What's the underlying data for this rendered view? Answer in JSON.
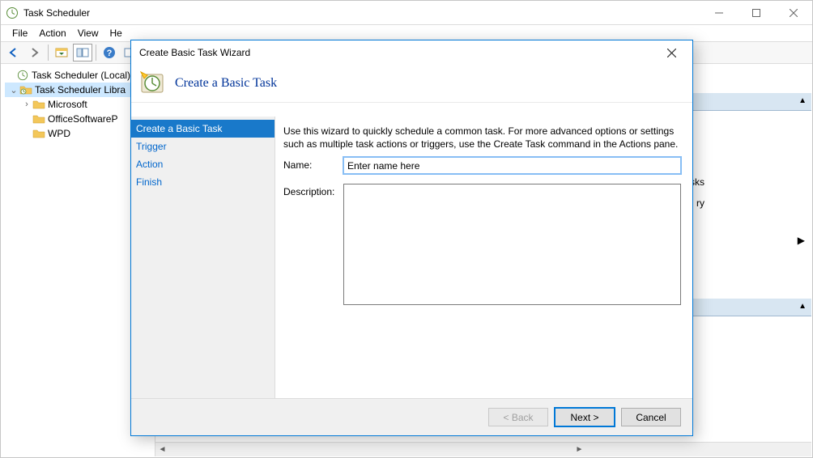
{
  "main_window": {
    "title": "Task Scheduler",
    "menu": {
      "file": "File",
      "action": "Action",
      "view": "View",
      "help": "He"
    },
    "tree": {
      "root": "Task Scheduler (Local)",
      "library": "Task Scheduler Libra",
      "items": [
        "Microsoft",
        "OfficeSoftwareP",
        "WPD"
      ]
    },
    "right_pane": {
      "side_asks": "asks",
      "side_ry": "ry"
    }
  },
  "dialog": {
    "title": "Create Basic Task Wizard",
    "header": "Create a Basic Task",
    "steps": [
      "Create a Basic Task",
      "Trigger",
      "Action",
      "Finish"
    ],
    "intro": "Use this wizard to quickly schedule a common task.  For more advanced options or settings such as multiple task actions or triggers, use the Create Task command in the Actions pane.",
    "name_label": "Name:",
    "name_value": "Enter name here",
    "desc_label": "Description:",
    "desc_value": "",
    "buttons": {
      "back": "< Back",
      "next": "Next >",
      "cancel": "Cancel"
    }
  }
}
